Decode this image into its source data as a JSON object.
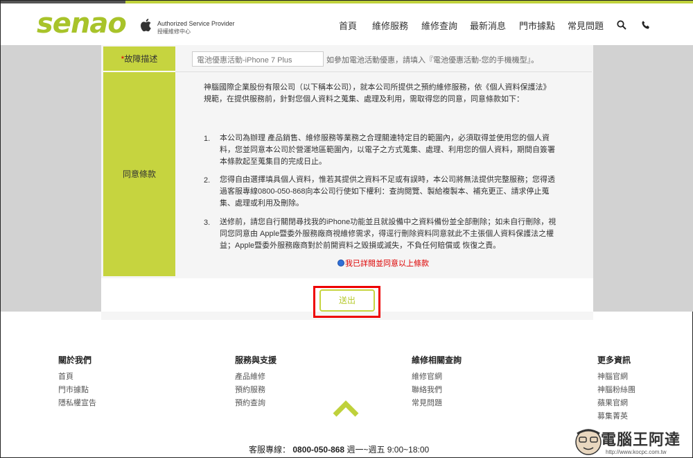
{
  "header": {
    "logo_text": "senao",
    "provider_title": "Authorized Service Provider",
    "provider_subtitle": "授權維修中心",
    "nav": [
      "首頁",
      "維修服務",
      "維修查詢",
      "最新消息",
      "門市據點",
      "常見問題"
    ],
    "accent_color": "#bfd13b"
  },
  "form": {
    "fault_label_required": "*",
    "fault_label": "故障描述",
    "fault_value": "電池優惠活動-iPhone 7 Plus",
    "fault_hint": "如參加電池活動優惠，請填入『電池優惠活動-您的手機機型』。",
    "terms_label": "同意條款",
    "intro_line1": "神腦國際企業股份有限公司（以下稱本公司），就本公司所提供之預約維修服務，依《個人資料保護法》",
    "intro_line2": "規範，在提供服務前，針對您個人資料之蒐集、處理及利用，需取得您的同意，同意條款如下：",
    "items": [
      {
        "num": "1.",
        "lines": [
          "本公司為辦理 產品銷售、維修服務等業務之合理關連特定目的範圍內，必須取得並使用您的個人資",
          "料，您並同意本公司於營運地區範圍內，以電子之方式蒐集、處理、利用您的個人資料，期間自簽署",
          "本條款起至蒐集目的完成日止。"
        ]
      },
      {
        "num": "2.",
        "lines": [
          "您得自由選擇填具個人資料，惟若其提供之資料不足或有誤時，本公司將無法提供完整服務；您得透",
          "過客服專線0800-050-868向本公司行使如下權利：查詢閱覽、製給複製本、補充更正、請求停止蒐",
          "集、處理或利用及刪除。"
        ]
      },
      {
        "num": "3.",
        "lines": [
          "送修前，請您自行關閉尋找我的iPhone功能並且就設備中之資料備份並全部刪除；如未自行刪除，視",
          "同您同意由 Apple暨委外服務廠商視維修需求，得逕行刪除資料同意就此不主張個人資料保護法之權",
          "益；Apple暨委外服務廠商對於前開資料之毀損或滅失，不負任何賠償或 恢復之責。"
        ]
      }
    ],
    "agree_text": "我已詳閱並同意以上條款",
    "submit_label": "送出"
  },
  "footer": {
    "columns": [
      {
        "title": "關於我們",
        "links": [
          "首頁",
          "門市據點",
          "隱私權宣告"
        ]
      },
      {
        "title": "服務與支援",
        "links": [
          "產品維修",
          "預約服務",
          "預約查詢"
        ]
      },
      {
        "title": "維修相關查詢",
        "links": [
          "維修官網",
          "聯絡我們",
          "常見問題"
        ]
      },
      {
        "title": "更多資訊",
        "links": [
          "神腦官網",
          "神腦粉絲團",
          "蘋果官網",
          "募集菁英"
        ]
      }
    ],
    "hotline_label": "客服專線：",
    "hotline_number": "0800-050-868",
    "hotline_hours": "週一~週五 9:00~18:00"
  },
  "watermark": {
    "text": "電腦王阿達",
    "url": "http://www.kocpc.com.tw"
  }
}
